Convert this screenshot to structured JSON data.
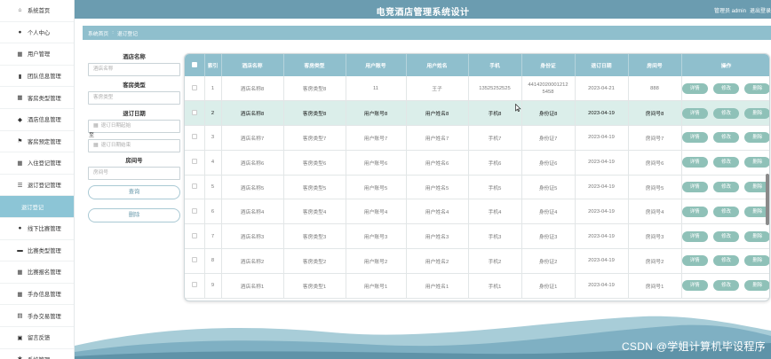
{
  "header": {
    "title": "电竞酒店管理系统设计",
    "user_text": "管理员 admin",
    "logout": "退出登录"
  },
  "sidebar": {
    "items": [
      {
        "icon": "home-icon",
        "glyph": "⌂",
        "label": "系统首页"
      },
      {
        "icon": "person-icon",
        "glyph": "●",
        "label": "个人中心"
      },
      {
        "icon": "grid-icon",
        "glyph": "▦",
        "label": "用户管理"
      },
      {
        "icon": "bar-chart-icon",
        "glyph": "▮",
        "label": "团队信息管理"
      },
      {
        "icon": "grid-icon",
        "glyph": "▦",
        "label": "客房类型管理"
      },
      {
        "icon": "location-icon",
        "glyph": "◆",
        "label": "酒店信息管理"
      },
      {
        "icon": "flag-icon",
        "glyph": "⚑",
        "label": "客房预定管理"
      },
      {
        "icon": "grid-icon",
        "glyph": "▦",
        "label": "入住登记管理"
      },
      {
        "icon": "list-icon",
        "glyph": "☰",
        "label": "退订登记管理"
      },
      {
        "icon": "",
        "glyph": "",
        "label": "退订登记",
        "active": true
      },
      {
        "icon": "person-icon",
        "glyph": "●",
        "label": "线下比赛管理"
      },
      {
        "icon": "briefcase-icon",
        "glyph": "▬",
        "label": "比赛类型管理"
      },
      {
        "icon": "grid-icon",
        "glyph": "▦",
        "label": "比赛报名管理"
      },
      {
        "icon": "grid-icon",
        "glyph": "▦",
        "label": "手办信息管理"
      },
      {
        "icon": "doc-icon",
        "glyph": "▤",
        "label": "手办交易管理"
      },
      {
        "icon": "note-icon",
        "glyph": "▣",
        "label": "留言反馈"
      },
      {
        "icon": "gear-icon",
        "glyph": "✱",
        "label": "系统管理"
      }
    ]
  },
  "breadcrumb": {
    "home": "系统首页",
    "sep": ":",
    "current": "退订登记"
  },
  "search": {
    "hotel_label": "酒店名称",
    "hotel_placeholder": "酒店名称",
    "room_type_label": "客房类型",
    "room_type_placeholder": "客房类型",
    "date_label": "退订日期",
    "date_start_placeholder": "退订日期起始",
    "date_to": "至",
    "date_end_placeholder": "退订日期结束",
    "room_no_label": "房间号",
    "room_no_placeholder": "房间号",
    "query_button": "查询",
    "delete_button": "删除"
  },
  "table": {
    "columns": [
      "",
      "索引",
      "酒店名称",
      "客房类型",
      "用户账号",
      "用户姓名",
      "手机",
      "身份证",
      "退订日期",
      "房间号",
      "操作"
    ],
    "actions": {
      "detail": "详情",
      "edit": "修改",
      "delete": "删除"
    },
    "rows": [
      [
        "1",
        "酒店名称8",
        "客房类型8",
        "11",
        "王子",
        "13525252525",
        "44142020001212 5458",
        "2023-04-21",
        "888"
      ],
      [
        "2",
        "酒店名称8",
        "客房类型8",
        "用户账号8",
        "用户姓名8",
        "手机8",
        "身份证8",
        "2023-04-19",
        "房间号8"
      ],
      [
        "3",
        "酒店名称7",
        "客房类型7",
        "用户账号7",
        "用户姓名7",
        "手机7",
        "身份证7",
        "2023-04-19",
        "房间号7"
      ],
      [
        "4",
        "酒店名称6",
        "客房类型6",
        "用户账号6",
        "用户姓名6",
        "手机6",
        "身份证6",
        "2023-04-19",
        "房间号6"
      ],
      [
        "5",
        "酒店名称5",
        "客房类型5",
        "用户账号5",
        "用户姓名5",
        "手机5",
        "身份证5",
        "2023-04-19",
        "房间号5"
      ],
      [
        "6",
        "酒店名称4",
        "客房类型4",
        "用户账号4",
        "用户姓名4",
        "手机4",
        "身份证4",
        "2023-04-19",
        "房间号4"
      ],
      [
        "7",
        "酒店名称3",
        "客房类型3",
        "用户账号3",
        "用户姓名3",
        "手机3",
        "身份证3",
        "2023-04-19",
        "房间号3"
      ],
      [
        "8",
        "酒店名称2",
        "客房类型2",
        "用户账号2",
        "用户姓名2",
        "手机2",
        "身份证2",
        "2023-04-19",
        "房间号2"
      ],
      [
        "9",
        "酒店名称1",
        "客房类型1",
        "用户账号1",
        "用户姓名1",
        "手机1",
        "身份证1",
        "2023-04-19",
        "房间号1"
      ]
    ]
  },
  "watermark": "CSDN @学姐计算机毕设程序",
  "colors": {
    "header": "#6b9cb0",
    "accent": "#8fbfcd",
    "button": "#8fc1b8",
    "highlight_row": "#dbeeea"
  }
}
